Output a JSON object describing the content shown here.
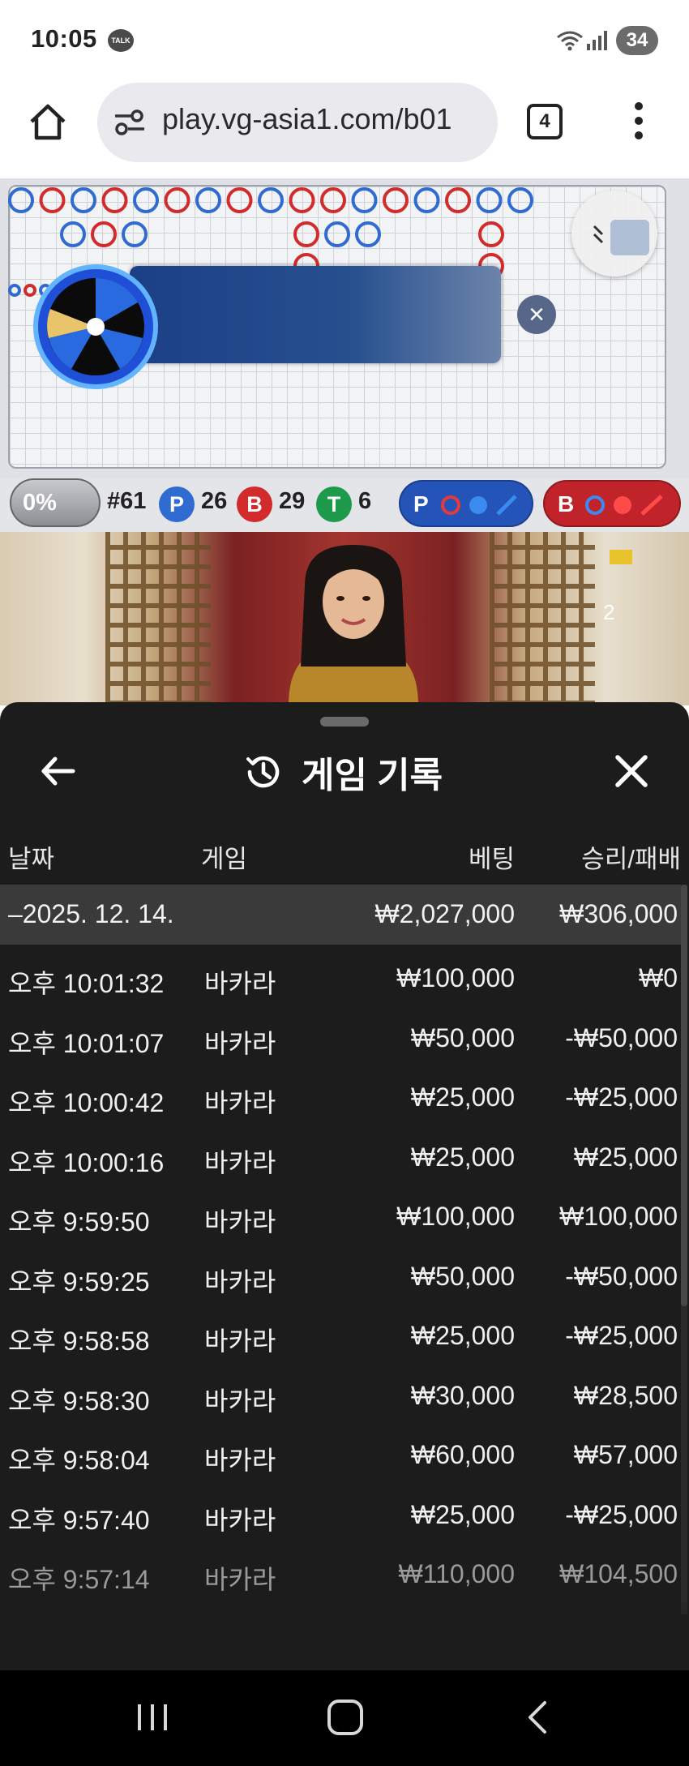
{
  "status_bar": {
    "time": "10:05",
    "talk_badge": "TALK",
    "battery": "34"
  },
  "browser": {
    "url": "play.vg-asia1.com/b01",
    "tab_count": "4"
  },
  "stats": {
    "progress": "0%",
    "shoe": "#61",
    "player_label": "P",
    "player_count": "26",
    "banker_label": "B",
    "banker_count": "29",
    "tie_label": "T",
    "tie_count": "6",
    "predict_player_label": "P",
    "predict_banker_label": "B"
  },
  "video": {
    "counter": "2"
  },
  "history": {
    "title": "게임 기록",
    "headers": {
      "date": "날짜",
      "game": "게임",
      "bet": "베팅",
      "result": "승리/패배"
    },
    "summary": {
      "date": "–2025. 12. 14.",
      "bet": "₩2,027,000",
      "result": "₩306,000"
    },
    "rows": [
      {
        "time": "오후 10:01:32",
        "game": "바카라",
        "bet": "₩100,000",
        "result": "₩0"
      },
      {
        "time": "오후 10:01:07",
        "game": "바카라",
        "bet": "₩50,000",
        "result": "-₩50,000"
      },
      {
        "time": "오후 10:00:42",
        "game": "바카라",
        "bet": "₩25,000",
        "result": "-₩25,000"
      },
      {
        "time": "오후 10:00:16",
        "game": "바카라",
        "bet": "₩25,000",
        "result": "₩25,000"
      },
      {
        "time": "오후 9:59:50",
        "game": "바카라",
        "bet": "₩100,000",
        "result": "₩100,000"
      },
      {
        "time": "오후 9:59:25",
        "game": "바카라",
        "bet": "₩50,000",
        "result": "-₩50,000"
      },
      {
        "time": "오후 9:58:58",
        "game": "바카라",
        "bet": "₩25,000",
        "result": "-₩25,000"
      },
      {
        "time": "오후 9:58:30",
        "game": "바카라",
        "bet": "₩30,000",
        "result": "₩28,500"
      },
      {
        "time": "오후 9:58:04",
        "game": "바카라",
        "bet": "₩60,000",
        "result": "₩57,000"
      },
      {
        "time": "오후 9:57:40",
        "game": "바카라",
        "bet": "₩25,000",
        "result": "-₩25,000"
      },
      {
        "time": "오후 9:57:14",
        "game": "바카라",
        "bet": "₩110,000",
        "result": "₩104,500"
      }
    ]
  },
  "colors": {
    "player": "#2f6bd1",
    "banker": "#d22b2b",
    "tie": "#1d9a4c",
    "panel_bg": "#1c1c1c",
    "summary_bg": "#3a3a3a"
  }
}
